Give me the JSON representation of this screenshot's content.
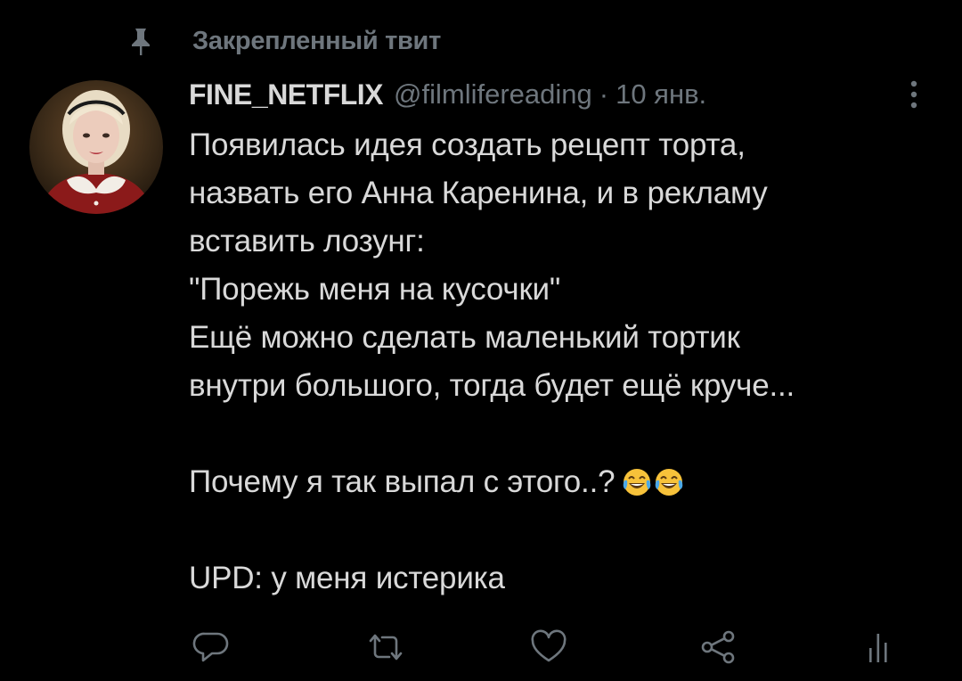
{
  "colors": {
    "background": "#000000",
    "text_primary": "#d9d9d9",
    "text_secondary": "#6e767d"
  },
  "pinned": {
    "icon": "pin-icon",
    "label": "Закрепленный твит"
  },
  "tweet": {
    "display_name": "FINE_NETFLIX",
    "handle": "@filmlifereading",
    "separator": "·",
    "date": "10 янв.",
    "more_icon": "more-vertical-icon",
    "lines": [
      "Появилась идея создать рецепт торта,",
      "назвать его Анна Каренина, и в рекламу",
      "вставить лозунг:",
      "\"Порежь меня на кусочки\"",
      "Ещё можно сделать маленький тортик",
      "внутри большого, тогда будет ещё круче...",
      "",
      "Почему я так выпал с этого..?",
      "",
      "UPD: у меня истерика"
    ],
    "emojis": [
      "face-with-tears-of-joy-icon",
      "face-with-tears-of-joy-icon"
    ]
  },
  "actions": [
    {
      "name": "reply-icon"
    },
    {
      "name": "retweet-icon"
    },
    {
      "name": "like-icon"
    },
    {
      "name": "share-icon"
    },
    {
      "name": "analytics-icon"
    }
  ]
}
